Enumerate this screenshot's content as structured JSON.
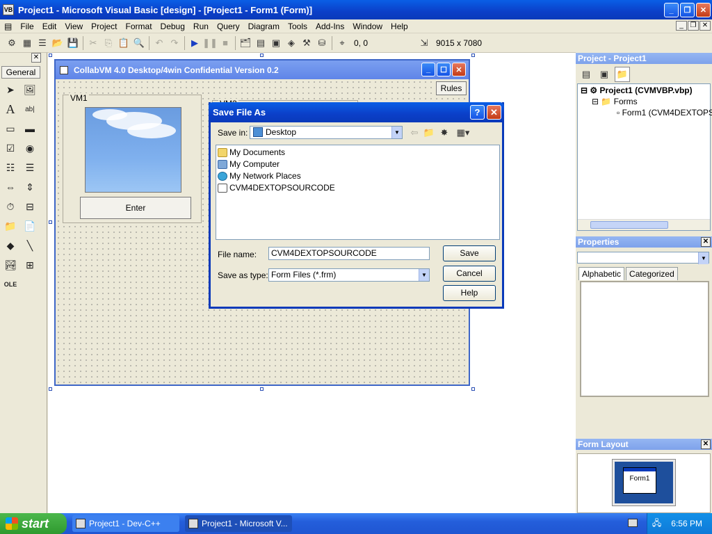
{
  "window": {
    "title": "Project1 - Microsoft Visual Basic [design] - [Project1 - Form1 (Form)]"
  },
  "menu": [
    "File",
    "Edit",
    "View",
    "Project",
    "Format",
    "Debug",
    "Run",
    "Query",
    "Diagram",
    "Tools",
    "Add-Ins",
    "Window",
    "Help"
  ],
  "toolbar": {
    "position": "0, 0",
    "size": "9015 x 7080"
  },
  "toolbox": {
    "tab_label": "General"
  },
  "form": {
    "title": "CollabVM 4.0 Desktop/4win Confidential Version 0.2",
    "rules_label": "Rules",
    "vm1_caption": "VM1",
    "vm2_caption": "VM2",
    "enter_label": "Enter"
  },
  "dialog": {
    "title": "Save File As",
    "help_glyph": "?",
    "save_in_label": "Save in:",
    "save_in_value": "Desktop",
    "items": [
      "My Documents",
      "My Computer",
      "My Network Places",
      "CVM4DEXTOPSOURCODE"
    ],
    "file_name_label": "File name:",
    "file_name_value": "CVM4DEXTOPSOURCODE",
    "save_as_type_label": "Save as type:",
    "save_as_type_value": "Form Files (*.frm)",
    "save_button": "Save",
    "cancel_button": "Cancel",
    "help_button": "Help"
  },
  "project_panel": {
    "title": "Project - Project1",
    "root": "Project1 (CVMVBP.vbp)",
    "folder": "Forms",
    "form_item": "Form1 (CVM4DEXTOPSC"
  },
  "properties_panel": {
    "title": "Properties",
    "tab_alphabetic": "Alphabetic",
    "tab_categorized": "Categorized"
  },
  "form_layout": {
    "title": "Form Layout",
    "form_label": "Form1"
  },
  "taskbar": {
    "start_label": "start",
    "tasks": [
      "Project1 - Dev-C++",
      "Project1 - Microsoft V..."
    ],
    "clock": "6:56 PM"
  },
  "colors": {
    "xp_blue": "#0a3aba",
    "taskbar": "#245edb",
    "start_green": "#2f9a2f",
    "face": "#ece9d8"
  }
}
